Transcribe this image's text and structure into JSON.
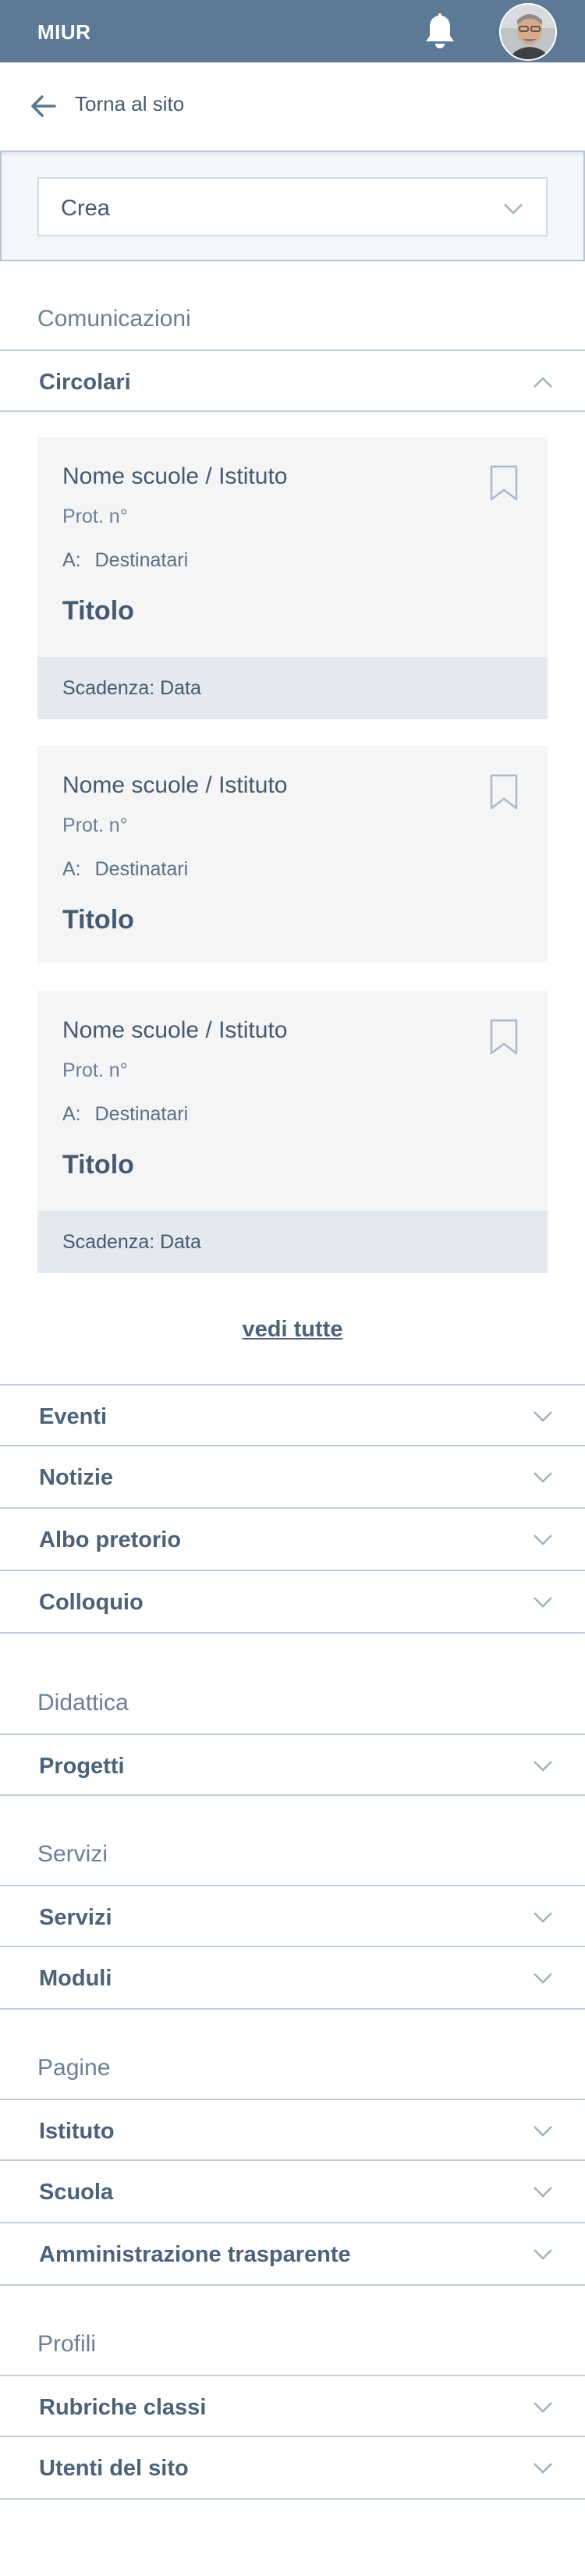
{
  "header": {
    "brand": "MIUR",
    "bell_icon": "bell-icon",
    "avatar_icon": "user-avatar"
  },
  "back": {
    "label": "Torna al sito",
    "icon": "arrow-left-icon"
  },
  "crea": {
    "label": "Crea",
    "icon": "chevron-down-icon"
  },
  "sections": {
    "comunicazioni": "Comunicazioni",
    "didattica": "Didattica",
    "servizi": "Servizi",
    "pagine": "Pagine",
    "profili": "Profili"
  },
  "circolari": {
    "label": "Circolari",
    "cards": [
      {
        "school": "Nome scuole / Istituto",
        "prot": "Prot. n°",
        "dest_prefix": "A:",
        "dest": "Destinatari",
        "title": "Titolo",
        "scadenza": "Scadenza: Data"
      },
      {
        "school": "Nome scuole / Istituto",
        "prot": "Prot. n°",
        "dest_prefix": "A:",
        "dest": "Destinatari",
        "title": "Titolo"
      },
      {
        "school": "Nome scuole / Istituto",
        "prot": "Prot. n°",
        "dest_prefix": "A:",
        "dest": "Destinatari",
        "title": "Titolo",
        "scadenza": "Scadenza: Data"
      }
    ],
    "vedi_tutte": "vedi tutte"
  },
  "items": {
    "eventi": "Eventi",
    "notizie": "Notizie",
    "albo": "Albo pretorio",
    "colloquio": "Colloquio",
    "progetti": "Progetti",
    "servizi": "Servizi",
    "moduli": "Moduli",
    "istituto": "Istituto",
    "scuola": "Scuola",
    "amministrazione": "Amministrazione trasparente",
    "rubriche": "Rubriche classi",
    "utenti": "Utenti del sito"
  }
}
